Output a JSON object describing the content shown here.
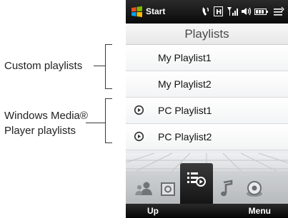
{
  "annotations": {
    "custom": "Custom playlists",
    "wmp_line1": "Windows Media®",
    "wmp_line2": "Player playlists"
  },
  "statusbar": {
    "start_label": "Start",
    "icons": [
      "windows-flag-icon",
      "phone-signal-icon",
      "h-data-icon",
      "signal-strength-icon",
      "volume-icon",
      "battery-icon",
      "menu-lines-icon"
    ]
  },
  "screen": {
    "title": "Playlists"
  },
  "playlists": [
    {
      "label": "My Playlist1",
      "type": "custom"
    },
    {
      "label": "My Playlist2",
      "type": "custom"
    },
    {
      "label": "PC Playlist1",
      "type": "pc"
    },
    {
      "label": "PC Playlist2",
      "type": "pc"
    }
  ],
  "tabs": [
    "people-icon",
    "photos-icon",
    "music-playlists-icon",
    "music-note-icon",
    "settings-disc-icon"
  ],
  "softkeys": {
    "left": "Up",
    "right": "Menu"
  },
  "colors": {
    "statusbar_bg": "#111111",
    "row_bg": "#ffffff",
    "tab_active": "#1c1c1c"
  }
}
